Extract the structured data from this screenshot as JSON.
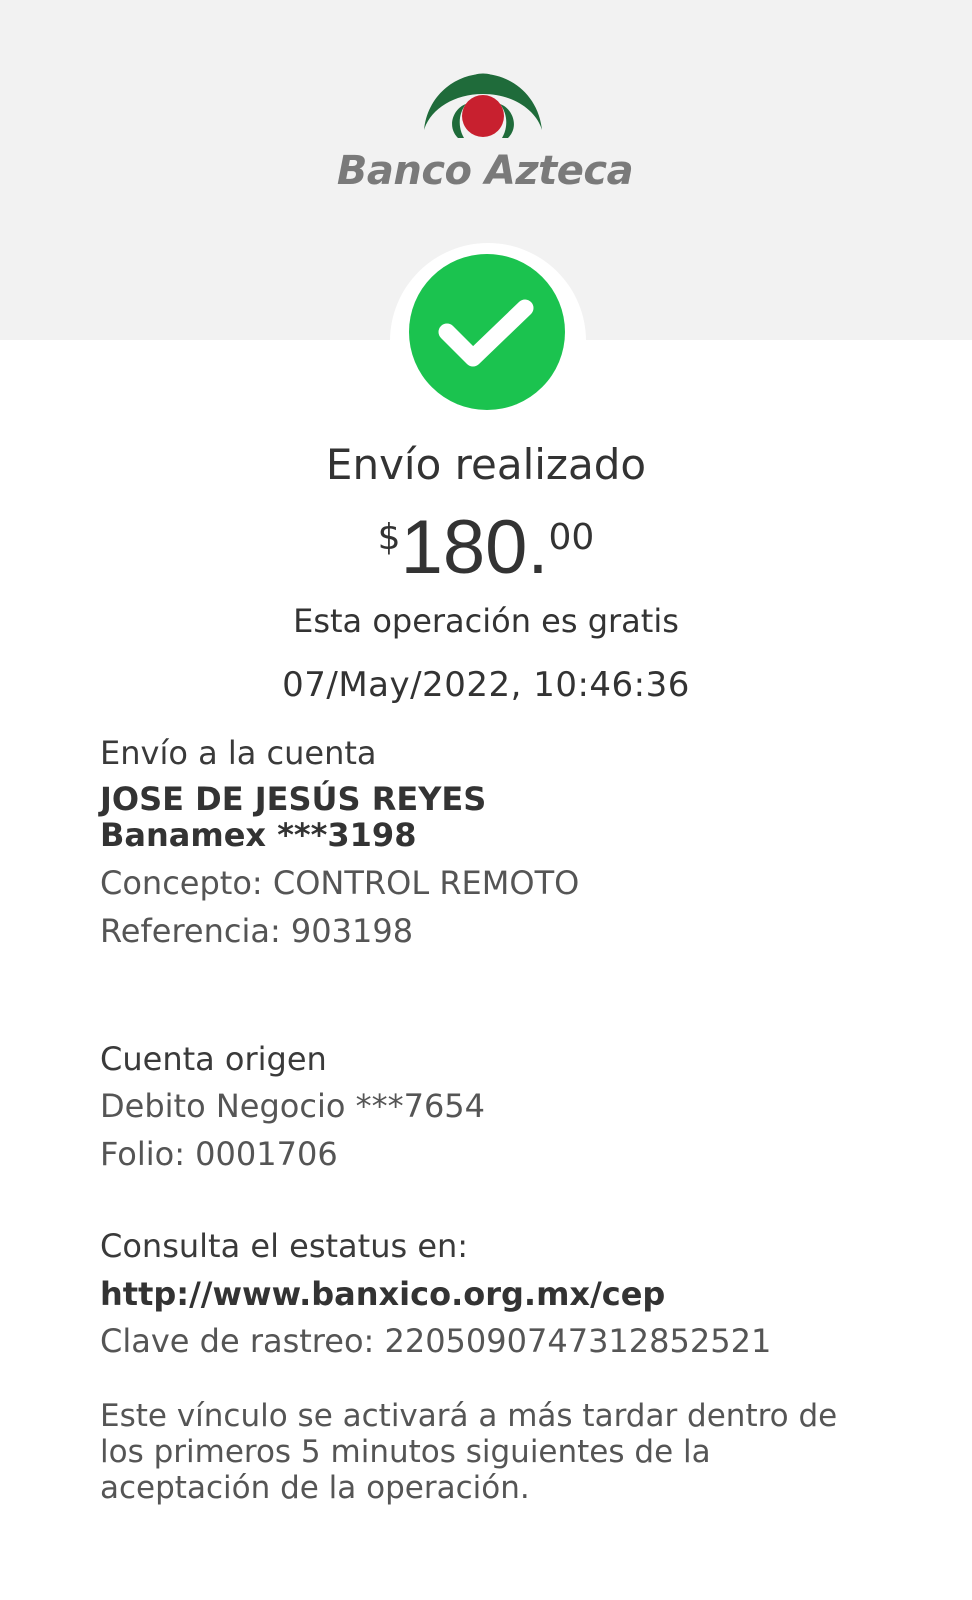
{
  "brand": {
    "name": "Banco Azteca"
  },
  "status": {
    "title": "Envío realizado"
  },
  "amount": {
    "currency": "$",
    "integer": "180.",
    "cents": "00"
  },
  "fee_note": "Esta operación es gratis",
  "datetime": "07/May/2022, 10:46:36",
  "destination": {
    "heading": "Envío a la cuenta",
    "beneficiary": "JOSE DE JESÚS  REYES",
    "account": "Banamex ***3198",
    "concept": "Concepto: CONTROL REMOTO",
    "reference": "Referencia: 903198"
  },
  "origin": {
    "heading": "Cuenta origen",
    "account": "Debito Negocio  ***7654",
    "folio": "Folio: 0001706"
  },
  "status_check": {
    "heading": "Consulta el estatus en:",
    "url": "http://www.banxico.org.mx/cep",
    "tracking": "Clave de rastreo: 2205090747312852521",
    "note": "Este vínculo se activará a más tardar dentro de los primeros 5 minutos siguientes de la aceptación de la operación."
  },
  "colors": {
    "success_green": "#1bc34f",
    "logo_green": "#1f6b3a",
    "logo_red": "#c8202f",
    "header_bg": "#f2f2f2"
  },
  "icons": [
    "banco-azteca-logo",
    "checkmark-icon"
  ]
}
